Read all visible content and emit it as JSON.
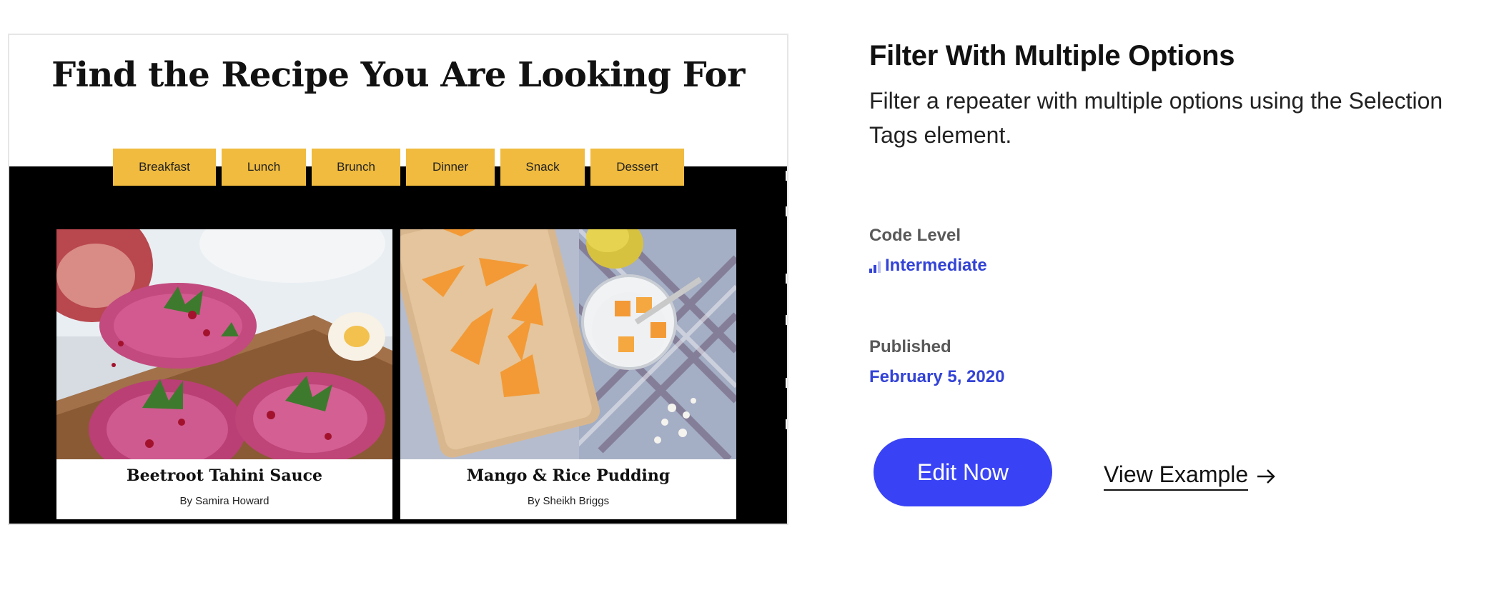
{
  "preview": {
    "heading": "Find the Recipe You Are Looking For",
    "tags": [
      "Breakfast",
      "Lunch",
      "Brunch",
      "Dinner",
      "Snack",
      "Dessert"
    ],
    "tag_color": "#f0bb3e",
    "cards": [
      {
        "title": "Beetroot Tahini Sauce",
        "author": "By Samira Howard",
        "image": "beetroot-toast-image"
      },
      {
        "title": "Mango & Rice Pudding",
        "author": "By Sheikh Briggs",
        "image": "mango-pudding-image"
      }
    ]
  },
  "info": {
    "title": "Filter With Multiple Options",
    "description": "Filter a repeater with multiple options using the Selection Tags element.",
    "code_level_label": "Code Level",
    "code_level_value": "Intermediate",
    "level_icon": "signal-bars-icon",
    "published_label": "Published",
    "published_value": "February 5, 2020",
    "accent_color": "#3343d6",
    "edit_button": "Edit Now",
    "view_link": "View Example",
    "view_link_icon": "arrow-right-icon",
    "button_color": "#3943f5"
  }
}
